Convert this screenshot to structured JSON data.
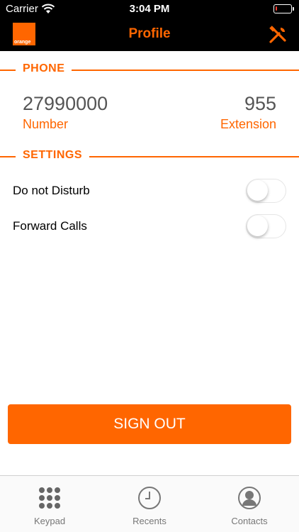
{
  "status_bar": {
    "carrier": "Carrier",
    "time": "3:04 PM",
    "battery_level": 0.1
  },
  "nav": {
    "logo_text": "orange",
    "title": "Profile",
    "tools_icon": "tools-icon"
  },
  "phone": {
    "header": "PHONE",
    "number": "27990000",
    "number_label": "Number",
    "extension": "955",
    "extension_label": "Extension"
  },
  "settings": {
    "header": "SETTINGS",
    "items": [
      {
        "label": "Do not Disturb",
        "enabled": false
      },
      {
        "label": "Forward Calls",
        "enabled": false
      }
    ]
  },
  "sign_out_label": "SIGN OUT",
  "tabs": [
    {
      "label": "Keypad",
      "icon": "keypad-icon"
    },
    {
      "label": "Recents",
      "icon": "clock-icon"
    },
    {
      "label": "Contacts",
      "icon": "contact-icon"
    }
  ],
  "colors": {
    "accent": "#ff6600",
    "bar": "#000000"
  }
}
